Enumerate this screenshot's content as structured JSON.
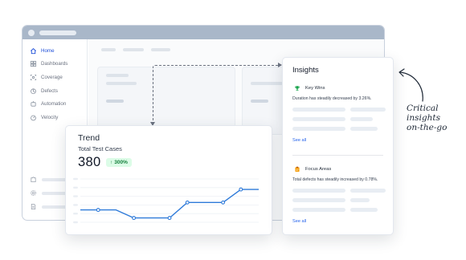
{
  "sidebar": {
    "items": [
      {
        "label": "Home",
        "icon": "home-icon"
      },
      {
        "label": "Dashboards",
        "icon": "dashboard-icon"
      },
      {
        "label": "Coverage",
        "icon": "coverage-icon"
      },
      {
        "label": "Defects",
        "icon": "defects-icon"
      },
      {
        "label": "Automation",
        "icon": "automation-icon"
      },
      {
        "label": "Velocity",
        "icon": "velocity-icon"
      }
    ]
  },
  "trend": {
    "title": "Trend",
    "subtitle": "Total Test Cases",
    "value": "380",
    "change": "300%",
    "change_icon": "arrow-up-icon"
  },
  "chart_data": {
    "type": "line",
    "x": [
      0,
      1,
      2,
      3,
      4,
      5,
      6,
      7,
      8,
      9,
      10
    ],
    "values": [
      2,
      2,
      2,
      0.7,
      0.7,
      0.7,
      3.2,
      3.2,
      3.2,
      5.3,
      5.3
    ],
    "markers": [
      1,
      3,
      5,
      6,
      8,
      9
    ],
    "ylim": [
      0,
      7
    ],
    "grid": true,
    "color": "#2e7ad9"
  },
  "insights": {
    "title": "Insights",
    "sections": [
      {
        "heading": "Key Wins",
        "icon": "trophy-icon",
        "text": "Duration has steadily decreased by 3.26%.",
        "link": "See all"
      },
      {
        "heading": "Focus Areas",
        "icon": "clipboard-icon",
        "text": "Total defects has steadily increased by 0.78%.",
        "link": "See all"
      }
    ]
  },
  "annotation": {
    "lines": [
      "Critical",
      "insights",
      "on-the-go"
    ]
  },
  "colors": {
    "accent": "#2563eb",
    "line": "#2e7ad9",
    "badge_bg": "#dcfce7",
    "badge_text": "#15803d",
    "titlebar": "#a9b7c9"
  }
}
